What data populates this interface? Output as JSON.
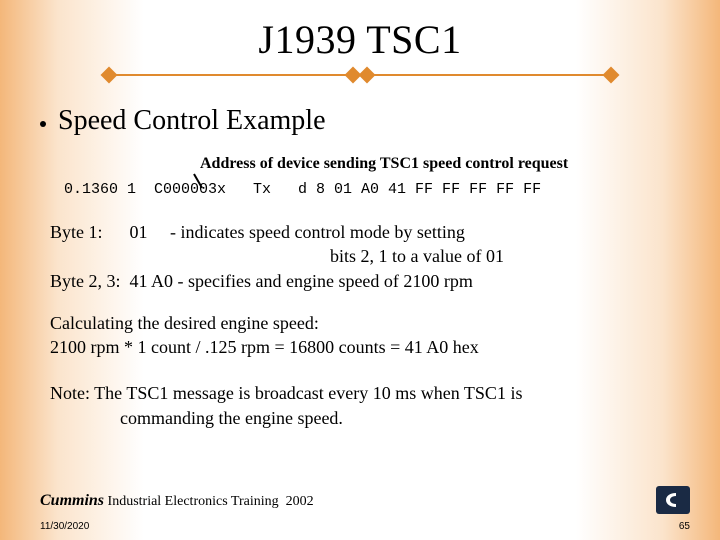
{
  "title": "J1939 TSC1",
  "subtitle": "Speed Control Example",
  "callout": "Address of device sending TSC1 speed control request",
  "trace": "0.1360 1  C000003x   Tx   d 8 01 A0 41 FF FF FF FF FF",
  "bytes": {
    "l1": "Byte 1:      01     - indicates speed control mode by setting",
    "l2": "bits 2, 1 to a value of 01",
    "l3": "Byte 2, 3:  41 A0 - specifies and engine speed of 2100 rpm"
  },
  "calc": {
    "l1": "Calculating the desired engine speed:",
    "l2": "2100 rpm * 1 count / .125 rpm = 16800 counts = 41 A0 hex"
  },
  "note": {
    "l1": "Note: The TSC1 message is broadcast every 10 ms when TSC1 is",
    "l2": "commanding the engine speed."
  },
  "footer": {
    "brand": "Cummins",
    "rest": " Industrial Electronics Training  2002"
  },
  "date": "11/30/2020",
  "page": "65"
}
